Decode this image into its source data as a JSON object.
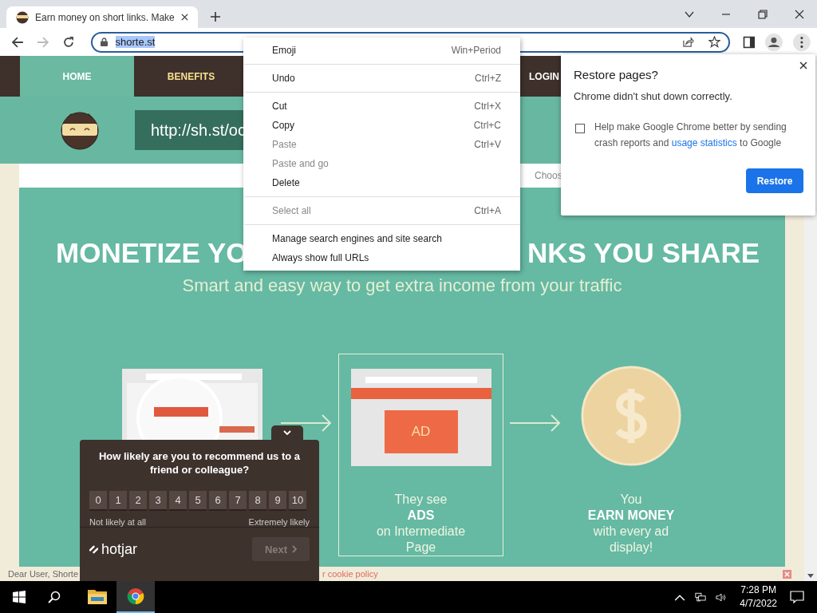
{
  "browser": {
    "tab": {
      "title": "Earn money on short links. Make"
    },
    "address": {
      "url": "shorte.st",
      "selected": true
    },
    "forward_disabled": true
  },
  "site": {
    "nav": [
      {
        "label": "HOME",
        "selected": true,
        "kind": "page"
      },
      {
        "label": "BENEFITS",
        "selected": false,
        "kind": "promo"
      },
      {
        "label": "LOGIN",
        "selected": false,
        "kind": "account"
      }
    ],
    "link_field": {
      "value": "http://sh.st/oc"
    },
    "language_label": "Choos",
    "headline": [
      "MONETIZE YO",
      "NKS YOU SHARE"
    ],
    "subtitle": "Smart and easy way to get extra income from your traffic",
    "steps": [
      {
        "kind": "search",
        "selected": false
      },
      {
        "kind": "ads",
        "selected": true,
        "ad_label": "AD",
        "text": "They see **ADS** on Intermediate Page"
      },
      {
        "kind": "money",
        "selected": false,
        "text": "You **EARN MONEY** with every ad display!"
      }
    ],
    "cookie_bar": {
      "text": "Dear User, Shorte",
      "link": "r cookie policy"
    }
  },
  "survey": {
    "question": "How likely are you to recommend us to a friend or colleague?",
    "scores": [
      {
        "label": "0",
        "selected": false
      },
      {
        "label": "1",
        "selected": false
      },
      {
        "label": "2",
        "selected": false
      },
      {
        "label": "3",
        "selected": false
      },
      {
        "label": "4",
        "selected": false
      },
      {
        "label": "5",
        "selected": false
      },
      {
        "label": "6",
        "selected": false
      },
      {
        "label": "7",
        "selected": false
      },
      {
        "label": "8",
        "selected": false
      },
      {
        "label": "9",
        "selected": false
      },
      {
        "label": "10",
        "selected": false
      }
    ],
    "low_label": "Not likely at all",
    "high_label": "Extremely likely",
    "brand": "hotjar",
    "next": {
      "label": "Next",
      "disabled": true
    }
  },
  "context_menu": [
    [
      {
        "label": "Emoji",
        "shortcut": "Win+Period",
        "disabled": false
      }
    ],
    [
      {
        "label": "Undo",
        "shortcut": "Ctrl+Z",
        "disabled": false
      }
    ],
    [
      {
        "label": "Cut",
        "shortcut": "Ctrl+X",
        "disabled": false
      },
      {
        "label": "Copy",
        "shortcut": "Ctrl+C",
        "disabled": false
      },
      {
        "label": "Paste",
        "shortcut": "Ctrl+V",
        "disabled": true
      },
      {
        "label": "Paste and go",
        "disabled": true
      },
      {
        "label": "Delete",
        "disabled": false
      }
    ],
    [
      {
        "label": "Select all",
        "shortcut": "Ctrl+A",
        "disabled": true
      }
    ],
    [
      {
        "label": "Manage search engines and site search",
        "disabled": false
      },
      {
        "label": "Always show full URLs",
        "disabled": false
      }
    ]
  ],
  "restore_dialog": {
    "title": "Restore pages?",
    "message": "Chrome didn't shut down correctly.",
    "checkbox": {
      "checked": false,
      "text_before": "Help make Google Chrome better by sending crash reports and",
      "link": "usage statistics",
      "text_after": "to Google"
    },
    "button": "Restore"
  },
  "taskbar": {
    "apps": [
      {
        "kind": "explorer",
        "selected": false
      },
      {
        "kind": "chrome",
        "selected": true
      }
    ],
    "time": "7:28 PM",
    "date": "4/7/2022"
  }
}
